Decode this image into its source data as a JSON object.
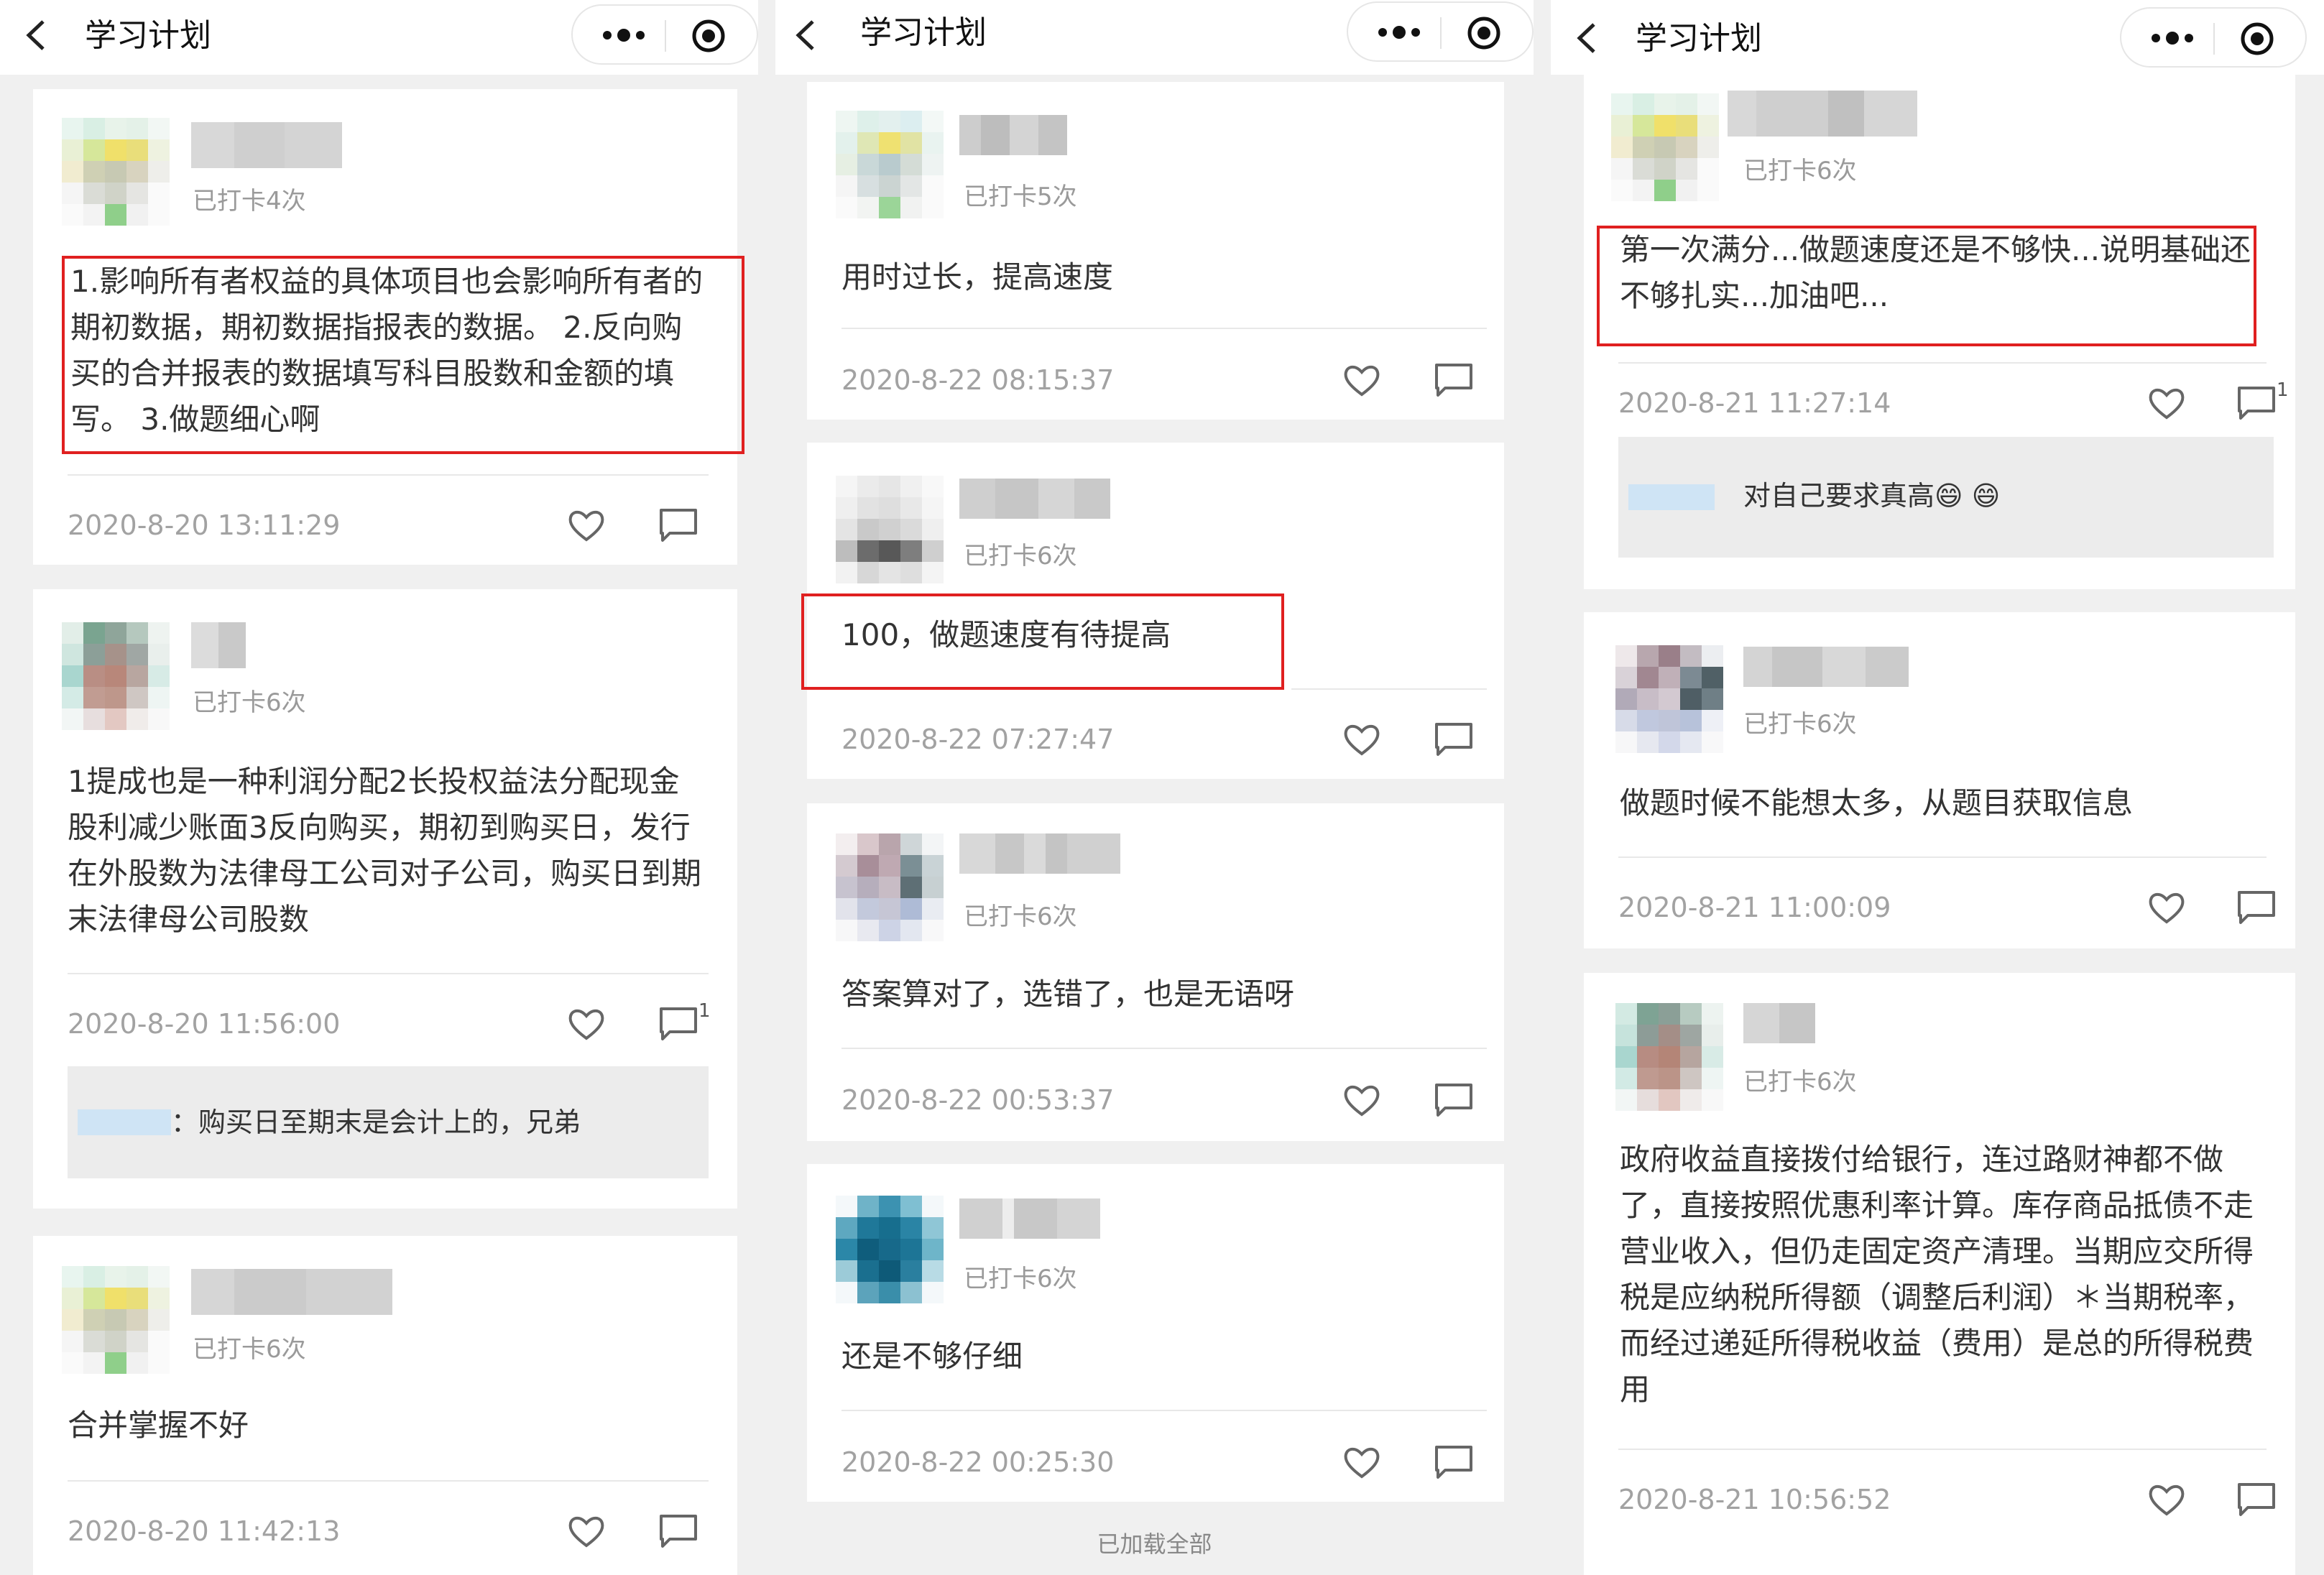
{
  "nav": {
    "title": "学习计划"
  },
  "columns": [
    {
      "posts": [
        {
          "checkin": "已打卡4次",
          "content": "1.影响所有者权益的具体项目也会影响所有者的期初数据，期初数据指报表的数据。 2.反向购买的合并报表的数据填写科目股数和金额的填写。 3.做题细心啊",
          "time": "2020-8-20 13:11:29"
        },
        {
          "checkin": "已打卡6次",
          "content": "1提成也是一种利润分配2长投权益法分配现金股利减少账面3反向购买，期初到购买日，发行在外股数为法律母工公司对子公司，购买日到期末法律母公司股数",
          "time": "2020-8-20 11:56:00",
          "comment_count": "1",
          "reply_text": "：购买日至期末是会计上的，兄弟"
        },
        {
          "checkin": "已打卡6次",
          "content": "合并掌握不好",
          "time": "2020-8-20 11:42:13"
        }
      ]
    },
    {
      "posts": [
        {
          "checkin": "已打卡5次",
          "content": "用时过长，提高速度",
          "time": "2020-8-22 08:15:37"
        },
        {
          "checkin": "已打卡6次",
          "content": "100，做题速度有待提高",
          "time": "2020-8-22 07:27:47"
        },
        {
          "checkin": "已打卡6次",
          "content": "答案算对了，选错了，也是无语呀",
          "time": "2020-8-22 00:53:37"
        },
        {
          "checkin": "已打卡6次",
          "content": "还是不够仔细",
          "time": "2020-8-22 00:25:30"
        }
      ],
      "footer": "已加载全部"
    },
    {
      "posts": [
        {
          "checkin": "已打卡6次",
          "content": "第一次满分...做题速度还是不够快...说明基础还不够扎实...加油吧...",
          "time": "2020-8-21 11:27:14",
          "comment_count": "1",
          "reply_text": "对自己要求真高😄 😄"
        },
        {
          "checkin": "已打卡6次",
          "content": "做题时候不能想太多，从题目获取信息",
          "time": "2020-8-21 11:00:09"
        },
        {
          "checkin": "已打卡6次",
          "content": "政府收益直接拨付给银行，连过路财神都不做了，直接按照优惠利率计算。库存商品抵债不走营业收入，但仍走固定资产清理。当期应交所得税是应纳税所得额（调整后利润）＊当期税率，而经过递延所得税收益（费用）是总的所得税费用",
          "time": "2020-8-21 10:56:52"
        }
      ]
    }
  ],
  "colors": {
    "highlight": "#e02020",
    "reply_bg": "#ececec",
    "page_bg": "#f0f0f0"
  },
  "icons": [
    "back-icon",
    "more-dots-icon",
    "target-icon",
    "heart-icon",
    "comment-icon"
  ]
}
